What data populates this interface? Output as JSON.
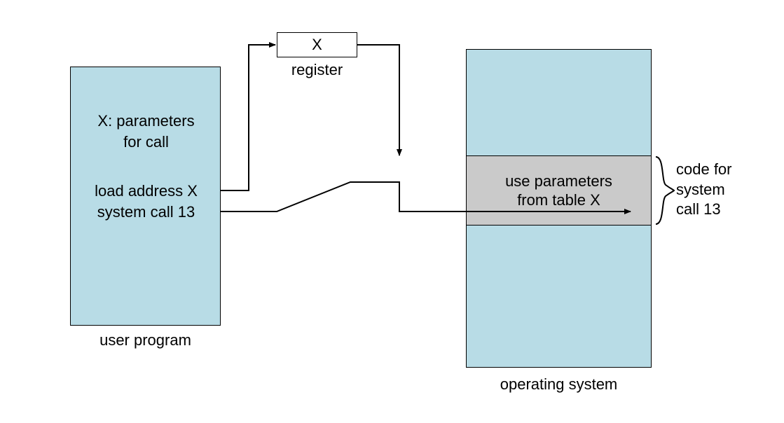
{
  "user_program": {
    "title_line1": "X: parameters",
    "title_line2": "for call",
    "line_load": "load address X",
    "line_syscall": "system call 13",
    "caption": "user program"
  },
  "register": {
    "value": "X",
    "caption": "register"
  },
  "os": {
    "mid_line1": "use parameters",
    "mid_line2": "from table X",
    "caption": "operating system"
  },
  "brace": {
    "line1": "code for",
    "line2": "system",
    "line3": "call 13"
  }
}
